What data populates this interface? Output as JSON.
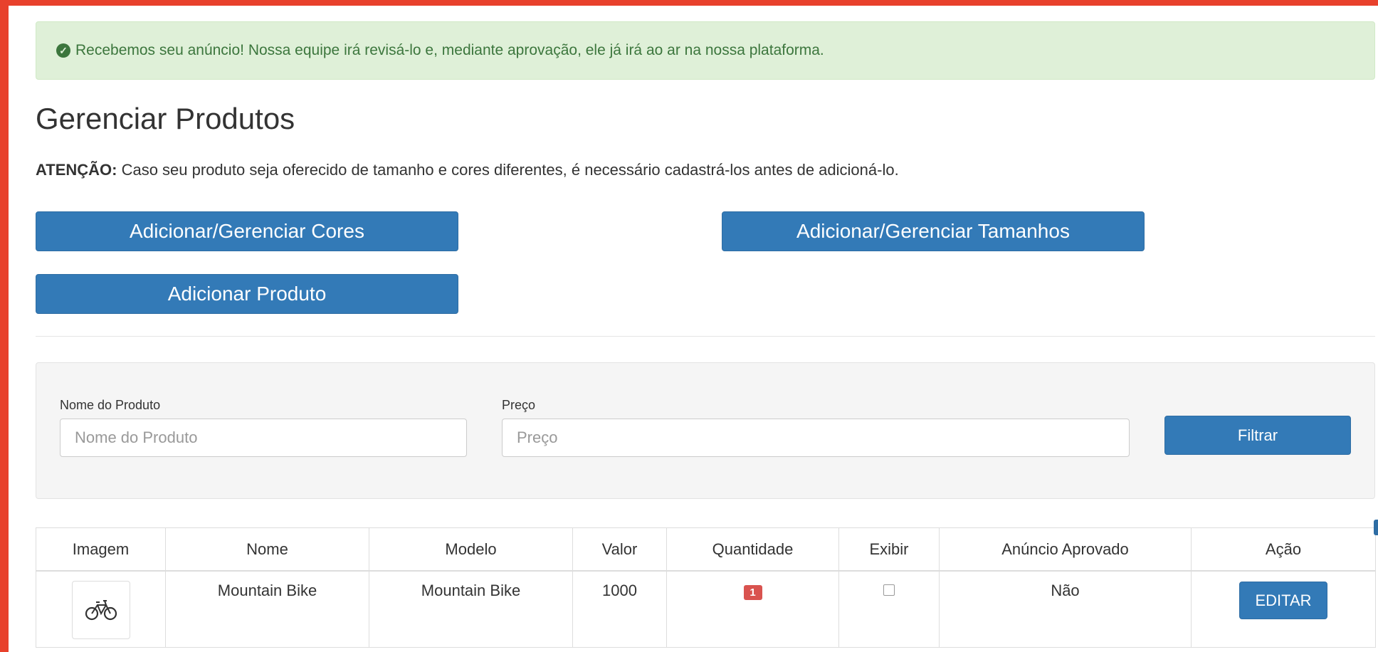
{
  "alert": {
    "icon": "check-circle-icon",
    "message": "Recebemos seu anúncio! Nossa equipe irá revisá-lo e, mediante aprovação, ele já irá ao ar na nossa plataforma."
  },
  "page_title": "Gerenciar Produtos",
  "attention": {
    "label": "ATENÇÃO:",
    "text": " Caso seu produto seja oferecido de tamanho e cores diferentes, é necessário cadastrá-los antes de adicioná-lo."
  },
  "buttons": {
    "cores": "Adicionar/Gerenciar Cores",
    "tamanhos": "Adicionar/Gerenciar Tamanhos",
    "produto": "Adicionar Produto"
  },
  "filter": {
    "name_label": "Nome do Produto",
    "name_placeholder": "Nome do Produto",
    "price_label": "Preço",
    "price_placeholder": "Preço",
    "submit": "Filtrar"
  },
  "table": {
    "headers": [
      "Imagem",
      "Nome",
      "Modelo",
      "Valor",
      "Quantidade",
      "Exibir",
      "Anúncio Aprovado",
      "Ação"
    ],
    "rows": [
      {
        "image_icon": "bicycle-icon",
        "nome": "Mountain Bike",
        "modelo": "Mountain Bike",
        "valor": "1000",
        "quantidade": "1",
        "exibir": false,
        "aprovado": "Não",
        "acao": "EDITAR"
      }
    ]
  },
  "colors": {
    "primary": "#337ab7",
    "success_bg": "#dff0d8",
    "success_text": "#3c763d",
    "danger": "#d9534f",
    "frame": "#e8412c"
  }
}
